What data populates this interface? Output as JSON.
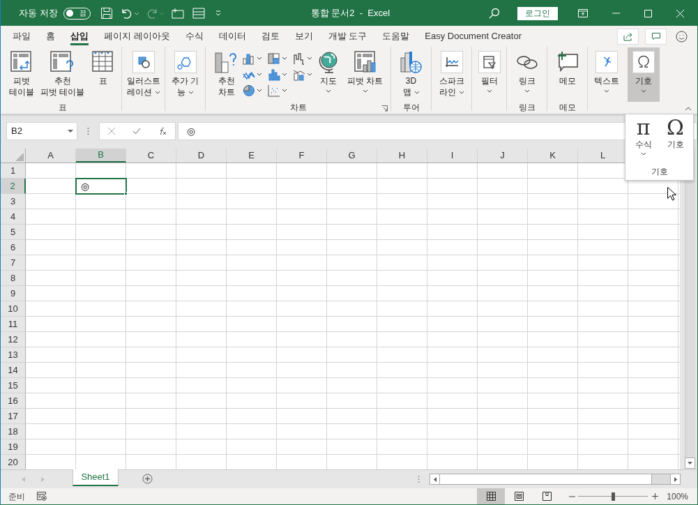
{
  "title_bar": {
    "autosave_label": "자동 저장",
    "autosave": {
      "label": "끔",
      "on": false
    },
    "redo_disabled": true,
    "title": "통합 문서2  -  Excel",
    "login": "로그인"
  },
  "menu_tabs": [
    {
      "label": "파일",
      "selected": false
    },
    {
      "label": "홈",
      "selected": false
    },
    {
      "label": "삽입",
      "selected": true
    },
    {
      "label": "페이지 레이아웃",
      "selected": false
    },
    {
      "label": "수식",
      "selected": false
    },
    {
      "label": "데이터",
      "selected": false
    },
    {
      "label": "검토",
      "selected": false
    },
    {
      "label": "보기",
      "selected": false
    },
    {
      "label": "개발 도구",
      "selected": false
    },
    {
      "label": "도움말",
      "selected": false
    },
    {
      "label": "Easy Document Creator",
      "selected": false
    }
  ],
  "ribbon_groups": [
    {
      "label": "표",
      "items": [
        {
          "kind": "button",
          "label": "피벗\n테이블",
          "dropdown": false,
          "expanded": false
        },
        {
          "kind": "button",
          "label": "추천\n피벗 테이블",
          "dropdown": false,
          "expanded": false
        },
        {
          "kind": "button",
          "label": "표",
          "dropdown": false,
          "expanded": false
        }
      ]
    },
    {
      "items": [
        {
          "kind": "button",
          "label": "일러스트\n레이션",
          "dropdown": true,
          "expanded": false
        }
      ]
    },
    {
      "items": [
        {
          "kind": "button",
          "label": "추가 기\n능",
          "dropdown": true,
          "expanded": false
        }
      ]
    },
    {
      "label": "차트",
      "launcher": true,
      "items": [
        {
          "kind": "button",
          "label": "추천\n차트",
          "dropdown": false,
          "expanded": false
        },
        {
          "kind": "gallery"
        },
        {
          "kind": "button",
          "label": "지도",
          "dropdown": true,
          "expanded": false
        },
        {
          "kind": "button",
          "label": "피벗 차트",
          "dropdown": true,
          "expanded": false
        }
      ]
    },
    {
      "label": "투어",
      "items": [
        {
          "kind": "button",
          "label": "3D\n맵",
          "dropdown": true,
          "expanded": false
        }
      ]
    },
    {
      "items": [
        {
          "kind": "button",
          "label": "스파크\n라인",
          "dropdown": true,
          "expanded": false
        }
      ]
    },
    {
      "items": [
        {
          "kind": "button",
          "label": "필터",
          "dropdown": true,
          "expanded": false
        }
      ]
    },
    {
      "label": "링크",
      "items": [
        {
          "kind": "button",
          "label": "링크",
          "dropdown": true,
          "expanded": false
        }
      ]
    },
    {
      "label": "메모",
      "items": [
        {
          "kind": "button",
          "label": "메모",
          "dropdown": false,
          "expanded": false
        }
      ]
    },
    {
      "items": [
        {
          "kind": "button",
          "label": "텍스트",
          "dropdown": true,
          "expanded": false
        }
      ]
    },
    {
      "items": [
        {
          "kind": "button",
          "label": "기호",
          "dropdown": true,
          "expanded": true
        }
      ]
    }
  ],
  "symbols_popup": {
    "items": [
      {
        "symbol": "π",
        "label": "수식",
        "dropdown": true
      },
      {
        "symbol": "Ω",
        "label": "기호",
        "dropdown": false
      }
    ],
    "group_label": "기호"
  },
  "formula_bar": {
    "name_box": "B2",
    "formula": "◎"
  },
  "grid": {
    "columns": [
      {
        "label": "A",
        "selected": false
      },
      {
        "label": "B",
        "selected": true
      },
      {
        "label": "C",
        "selected": false
      },
      {
        "label": "D",
        "selected": false
      },
      {
        "label": "E",
        "selected": false
      },
      {
        "label": "F",
        "selected": false
      },
      {
        "label": "G",
        "selected": false
      },
      {
        "label": "H",
        "selected": false
      },
      {
        "label": "I",
        "selected": false
      },
      {
        "label": "J",
        "selected": false
      },
      {
        "label": "K",
        "selected": false
      },
      {
        "label": "L",
        "selected": false
      }
    ],
    "rows": [
      {
        "label": "1",
        "selected": false
      },
      {
        "label": "2",
        "selected": true
      },
      {
        "label": "3",
        "selected": false
      },
      {
        "label": "4",
        "selected": false
      },
      {
        "label": "5",
        "selected": false
      },
      {
        "label": "6",
        "selected": false
      },
      {
        "label": "7",
        "selected": false
      },
      {
        "label": "8",
        "selected": false
      },
      {
        "label": "9",
        "selected": false
      },
      {
        "label": "10",
        "selected": false
      },
      {
        "label": "11",
        "selected": false
      },
      {
        "label": "12",
        "selected": false
      },
      {
        "label": "13",
        "selected": false
      },
      {
        "label": "14",
        "selected": false
      },
      {
        "label": "15",
        "selected": false
      },
      {
        "label": "16",
        "selected": false
      },
      {
        "label": "17",
        "selected": false
      },
      {
        "label": "18",
        "selected": false
      },
      {
        "label": "19",
        "selected": false
      },
      {
        "label": "20",
        "selected": false
      }
    ],
    "active_cell": {
      "value": "◎"
    }
  },
  "sheet_tabs": [
    {
      "label": "Sheet1",
      "selected": true
    }
  ],
  "status_bar": {
    "status": "준비",
    "view_buttons": [
      {
        "selected": true
      },
      {
        "selected": false
      },
      {
        "selected": false
      }
    ],
    "zoom": {
      "level": 0.5,
      "reading": "100%"
    }
  }
}
